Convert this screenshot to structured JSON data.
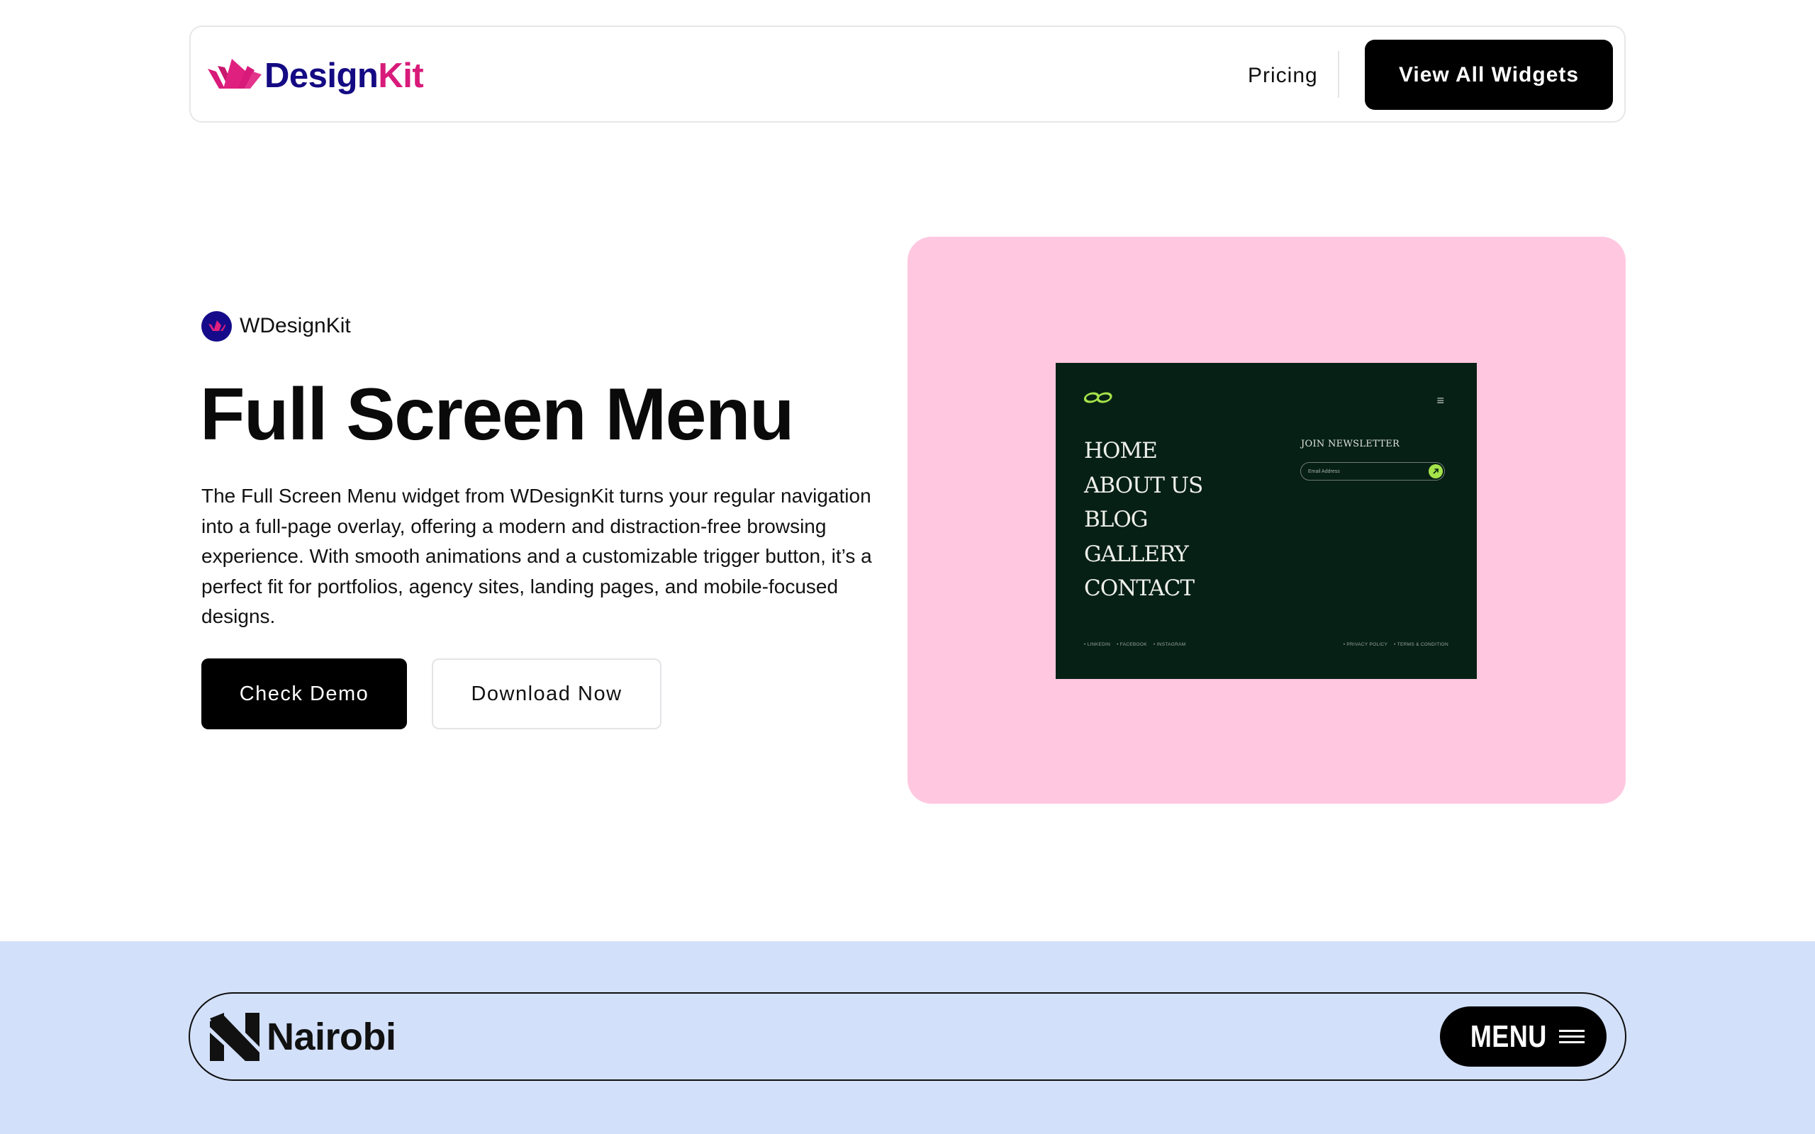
{
  "header": {
    "brand_prefix": "Design",
    "brand_suffix": "Kit",
    "brand_icon": "designkit-crown-logo",
    "nav_pricing": "Pricing",
    "cta_label": "View All Widgets"
  },
  "hero": {
    "badge_label": "WDesignKit",
    "title": "Full Screen Menu",
    "description": "The Full Screen Menu widget from WDesignKit turns your regular navigation into a full-page overlay, offering a modern and distraction-free browsing experience. With smooth animations and a customizable trigger button, it’s a perfect fit for portfolios, agency sites, landing pages, and mobile-focused designs.",
    "btn_demo": "Check Demo",
    "btn_download": "Download Now"
  },
  "preview": {
    "background": "#ffc8e0",
    "menu_items": [
      "HOME",
      "ABOUT US",
      "BLOG",
      "GALLERY",
      "CONTACT"
    ],
    "newsletter_title": "JOIN NEWSLETTER",
    "newsletter_placeholder": "Email Address",
    "footer_left": [
      "• LINKEDIN",
      "• FACEBOOK",
      "• INSTAGRAM"
    ],
    "footer_right": [
      "• PRIVACY POLICY",
      "• TERMS & CONDITION"
    ],
    "accent": "#a5e34a"
  },
  "section2": {
    "background": "#d3e0fa",
    "brand_name": "Nairobi",
    "menu_label": "MENU"
  },
  "colors": {
    "brand_navy": "#140a83",
    "brand_pink": "#d81b7a",
    "primary_button": "#000000"
  }
}
